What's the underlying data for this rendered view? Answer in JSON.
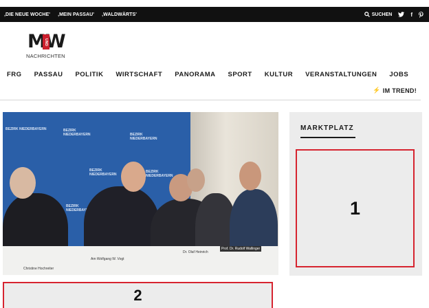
{
  "topbar": {
    "links": [
      ",DIE NEUE WOCHE'",
      ",MEIN PASSAU'",
      ",WALDWÄRTS'"
    ],
    "search_label": "SUCHEN",
    "icons": [
      "search-icon",
      "twitter-icon",
      "facebook-icon",
      "pinterest-icon"
    ]
  },
  "logo": {
    "main": "MW",
    "middle": "UND",
    "sub": "NACHRICHTEN"
  },
  "nav": [
    "FRG",
    "PASSAU",
    "POLITIK",
    "WIRTSCHAFT",
    "PANORAMA",
    "SPORT",
    "KULTUR",
    "VERANSTALTUNGEN",
    "JOBS"
  ],
  "trend": {
    "label": "IM TREND!"
  },
  "photo": {
    "banner_text": "BEZIRK NIEDERBAYERN",
    "name_cards": [
      "Christine Hochreiter",
      "Am Wolfgang W. Vogt",
      "Dr. Olaf Heinrich",
      "Prof. Dr. Rudolf Wallinger"
    ]
  },
  "sidebar": {
    "title": "MARKTPLATZ",
    "ad1_label": "1"
  },
  "ad2_label": "2",
  "colors": {
    "topbar": "#111111",
    "accent_red": "#d6232f",
    "sidebar_bg": "#ececec",
    "photo_blue": "#2a5fa8"
  }
}
